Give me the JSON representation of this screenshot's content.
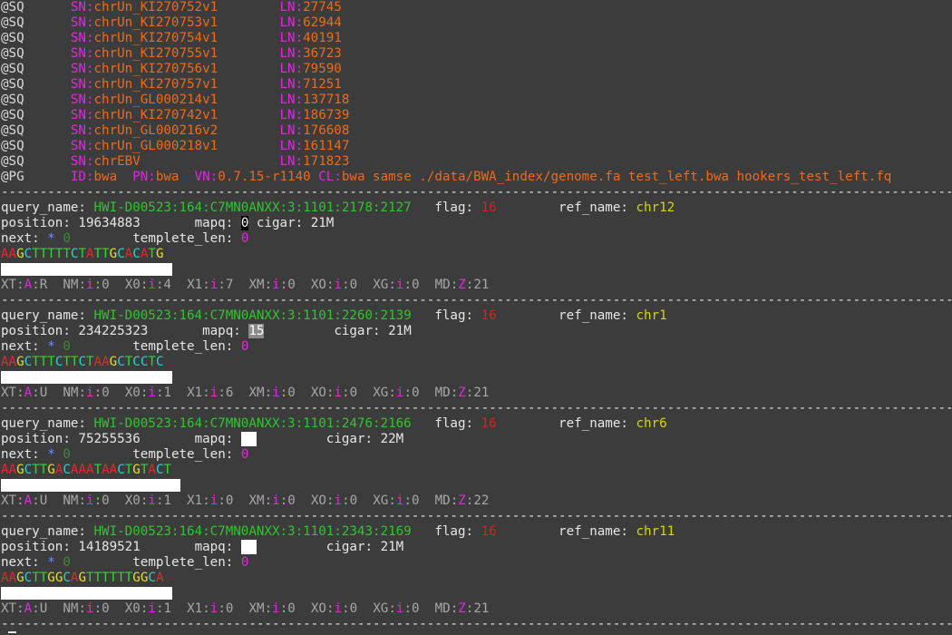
{
  "header_lines": [
    {
      "tag": "@SQ",
      "sn": "chrUn_KI270752v1",
      "ln": "27745"
    },
    {
      "tag": "@SQ",
      "sn": "chrUn_KI270753v1",
      "ln": "62944"
    },
    {
      "tag": "@SQ",
      "sn": "chrUn_KI270754v1",
      "ln": "40191"
    },
    {
      "tag": "@SQ",
      "sn": "chrUn_KI270755v1",
      "ln": "36723"
    },
    {
      "tag": "@SQ",
      "sn": "chrUn_KI270756v1",
      "ln": "79590"
    },
    {
      "tag": "@SQ",
      "sn": "chrUn_KI270757v1",
      "ln": "71251"
    },
    {
      "tag": "@SQ",
      "sn": "chrUn_GL000214v1",
      "ln": "137718"
    },
    {
      "tag": "@SQ",
      "sn": "chrUn_KI270742v1",
      "ln": "186739"
    },
    {
      "tag": "@SQ",
      "sn": "chrUn_GL000216v2",
      "ln": "176608"
    },
    {
      "tag": "@SQ",
      "sn": "chrUn_GL000218v1",
      "ln": "161147"
    },
    {
      "tag": "@SQ",
      "sn": "chrEBV",
      "ln": "171823"
    }
  ],
  "pg_line": {
    "tag": "@PG",
    "id": "bwa",
    "pn": "bwa",
    "vn": "0.7.15-r1140",
    "cl": "bwa samse ./data/BWA_index/genome.fa test_left.bwa hookers_test_left.fq"
  },
  "labels": {
    "sn": "SN:",
    "ln": "LN:",
    "id": "ID:",
    "pn": "PN:",
    "vn": "VN:",
    "cl": "CL:",
    "query_name": "query_name: ",
    "flag": "flag: ",
    "ref_name": "ref_name: ",
    "position": "position: ",
    "mapq": "mapq: ",
    "cigar": "cigar: ",
    "next": "next: ",
    "templete_len": "templete_len: ",
    "separator": "-------------------------------------------------------------------------------------------------------------------------------------------------------"
  },
  "records": [
    {
      "query_name": "HWI-D00523:164:C7MN0ANXX:3:1101:2178:2127",
      "flag": "16",
      "ref_name": "chr12",
      "position": "19634883",
      "mapq": "0",
      "mapq_style": "dark",
      "cigar": "21M",
      "next_ref": "*",
      "next_pos": "0",
      "templete_len": "0",
      "sequence": "AAGCTTTTTCTATTGCACATG",
      "tags": [
        {
          "n": "XT",
          "t": "A",
          "v": "R"
        },
        {
          "n": "NM",
          "t": "i",
          "v": "0"
        },
        {
          "n": "X0",
          "t": "i",
          "v": "4"
        },
        {
          "n": "X1",
          "t": "i",
          "v": "7"
        },
        {
          "n": "XM",
          "t": "i",
          "v": "0"
        },
        {
          "n": "XO",
          "t": "i",
          "v": "0"
        },
        {
          "n": "XG",
          "t": "i",
          "v": "0"
        },
        {
          "n": "MD",
          "t": "Z",
          "v": "21"
        }
      ]
    },
    {
      "query_name": "HWI-D00523:164:C7MN0ANXX:3:1101:2260:2139",
      "flag": "16",
      "ref_name": "chr1",
      "position": "234225323",
      "mapq": "15",
      "mapq_style": "gray",
      "cigar": "21M",
      "next_ref": "*",
      "next_pos": "0",
      "templete_len": "0",
      "sequence": "AAGCTTTCTTCTAAGCTCCTC",
      "tags": [
        {
          "n": "XT",
          "t": "A",
          "v": "U"
        },
        {
          "n": "NM",
          "t": "i",
          "v": "0"
        },
        {
          "n": "X0",
          "t": "i",
          "v": "1"
        },
        {
          "n": "X1",
          "t": "i",
          "v": "6"
        },
        {
          "n": "XM",
          "t": "i",
          "v": "0"
        },
        {
          "n": "XO",
          "t": "i",
          "v": "0"
        },
        {
          "n": "XG",
          "t": "i",
          "v": "0"
        },
        {
          "n": "MD",
          "t": "Z",
          "v": "21"
        }
      ]
    },
    {
      "query_name": "HWI-D00523:164:C7MN0ANXX:3:1101:2476:2166",
      "flag": "16",
      "ref_name": "chr6",
      "position": "75255536",
      "mapq": "  ",
      "mapq_style": "white",
      "cigar": "22M",
      "next_ref": "*",
      "next_pos": "0",
      "templete_len": "0",
      "sequence": "AAGCTTGACAAATAACTGTACT",
      "tags": [
        {
          "n": "XT",
          "t": "A",
          "v": "U"
        },
        {
          "n": "NM",
          "t": "i",
          "v": "0"
        },
        {
          "n": "X0",
          "t": "i",
          "v": "1"
        },
        {
          "n": "X1",
          "t": "i",
          "v": "0"
        },
        {
          "n": "XM",
          "t": "i",
          "v": "0"
        },
        {
          "n": "XO",
          "t": "i",
          "v": "0"
        },
        {
          "n": "XG",
          "t": "i",
          "v": "0"
        },
        {
          "n": "MD",
          "t": "Z",
          "v": "22"
        }
      ]
    },
    {
      "query_name": "HWI-D00523:164:C7MN0ANXX:3:1101:2343:2169",
      "flag": "16",
      "ref_name": "chr11",
      "position": "14189521",
      "mapq": "  ",
      "mapq_style": "white",
      "cigar": "21M",
      "next_ref": "*",
      "next_pos": "0",
      "templete_len": "0",
      "sequence": "AAGCTTGGCAGTTTTTTGGCA",
      "tags": [
        {
          "n": "XT",
          "t": "A",
          "v": "U"
        },
        {
          "n": "NM",
          "t": "i",
          "v": "0"
        },
        {
          "n": "X0",
          "t": "i",
          "v": "1"
        },
        {
          "n": "X1",
          "t": "i",
          "v": "0"
        },
        {
          "n": "XM",
          "t": "i",
          "v": "0"
        },
        {
          "n": "XO",
          "t": "i",
          "v": "0"
        },
        {
          "n": "XG",
          "t": "i",
          "v": "0"
        },
        {
          "n": "MD",
          "t": "Z",
          "v": "21"
        }
      ]
    }
  ],
  "colors": {
    "background": "#3c3c3c",
    "tag": "#e028e0",
    "value": "#ee6a1a",
    "query_name": "#2fc52f",
    "flag": "#e01c1c",
    "ref_name": "#d6d600",
    "next_ref": "#6b8cff",
    "templete_len": "#e028e0"
  }
}
